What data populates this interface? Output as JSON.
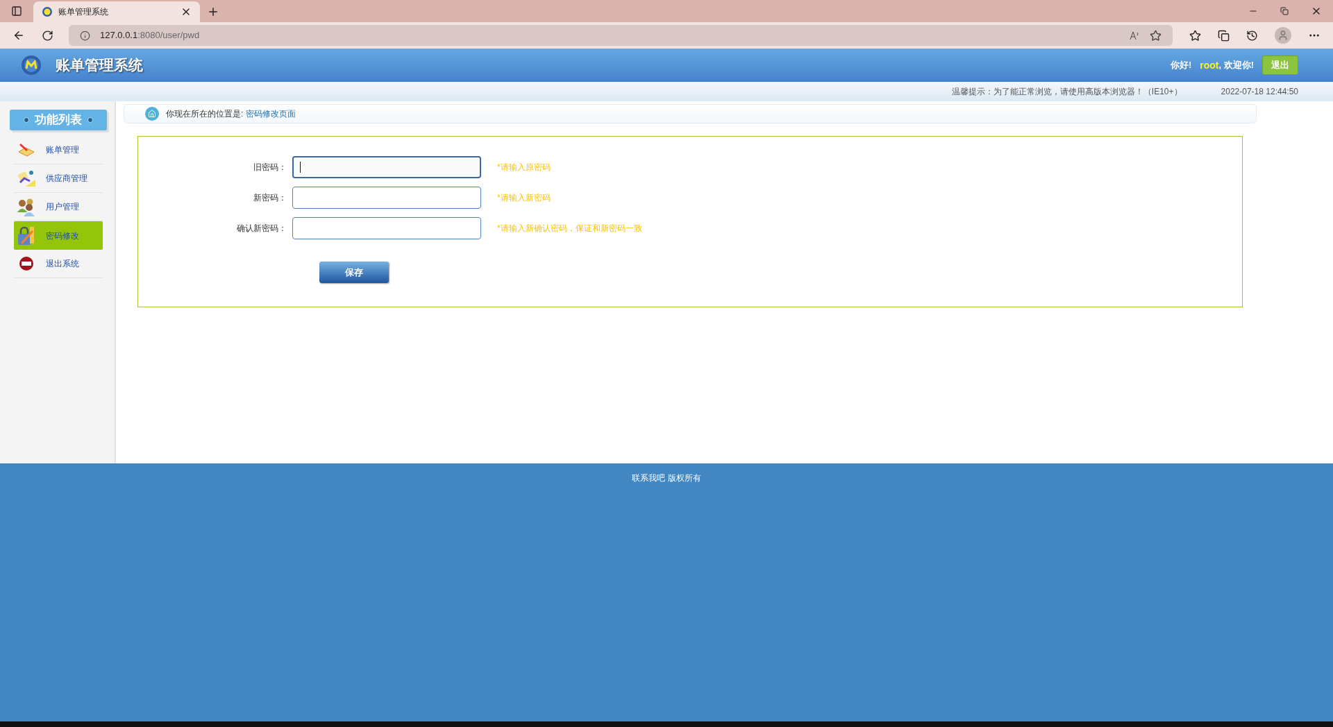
{
  "browser": {
    "tab_title": "账单管理系统",
    "url_host": "127.0.0.1",
    "url_rest": ":8080/user/pwd"
  },
  "header": {
    "title": "账单管理系统",
    "greeting": "你好!",
    "user": "root",
    "welcome": ", 欢迎你!",
    "logout": "退出"
  },
  "notice": {
    "tip": "温馨提示：为了能正常浏览，请使用高版本浏览器！（IE10+）",
    "datetime": "2022-07-18 12:44:50"
  },
  "sidebar": {
    "title": "功能列表",
    "items": [
      {
        "label": "账单管理",
        "selected": false
      },
      {
        "label": "供应商管理",
        "selected": false
      },
      {
        "label": "用户管理",
        "selected": false
      },
      {
        "label": "密码修改",
        "selected": true
      },
      {
        "label": "退出系统",
        "selected": false
      }
    ]
  },
  "breadcrumb": {
    "label": "你现在所在的位置是:",
    "page": "密码修改页面"
  },
  "form": {
    "fields": [
      {
        "label": "旧密码：",
        "hint": "*请输入原密码",
        "focused": true
      },
      {
        "label": "新密码：",
        "hint": "*请输入新密码",
        "focused": false
      },
      {
        "label": "确认新密码：",
        "hint": "*请输入新确认密码，保证和新密码一致",
        "focused": false
      }
    ],
    "save": "保存"
  },
  "footer": "联系我吧 版权所有"
}
